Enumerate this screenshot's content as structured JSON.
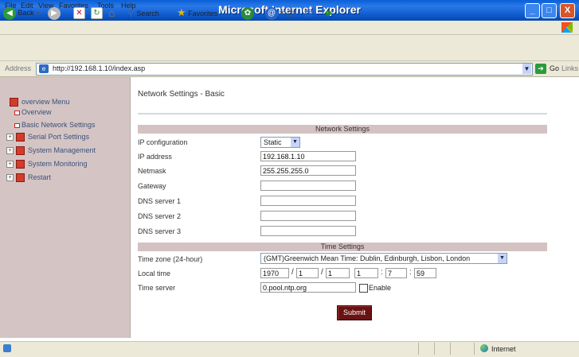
{
  "window": {
    "title": "Microsoft Internet Explorer",
    "min_glyph": "_",
    "max_glyph": "□",
    "close_glyph": "X"
  },
  "menubar": [
    "File",
    "Edit",
    "View",
    "Favorites",
    "Tools",
    "Help"
  ],
  "toolbar": {
    "back": "Back",
    "search": "Search",
    "favorites": "Favorites"
  },
  "address": {
    "label": "Address",
    "url": "http://192.168.1.10/index.asp",
    "go": "Go",
    "links": "Links"
  },
  "nav": {
    "header": "overview Menu",
    "items": [
      {
        "label": "Overview"
      },
      {
        "label": "Basic Network Settings"
      }
    ],
    "sections": [
      {
        "label": "Serial Port Settings"
      },
      {
        "label": "System Management"
      },
      {
        "label": "System Monitoring"
      },
      {
        "label": "Restart"
      }
    ]
  },
  "page": {
    "title": "Network Settings - Basic"
  },
  "network": {
    "header": "Network Settings",
    "ip_config_label": "IP configuration",
    "ip_config_value": "Static",
    "ip_address_label": "IP address",
    "ip_address": "192.168.1.10",
    "netmask_label": "Netmask",
    "netmask": "255.255.255.0",
    "gateway_label": "Gateway",
    "gateway": "",
    "dns1_label": "DNS server 1",
    "dns1": "",
    "dns2_label": "DNS server 2",
    "dns2": "",
    "dns3_label": "DNS server 3",
    "dns3": ""
  },
  "time": {
    "header": "Time Settings",
    "zone_label": "Time zone (24-hour)",
    "zone_value": "(GMT)Greenwich Mean Time: Dublin, Edinburgh, Lisbon, London",
    "local_label": "Local time",
    "year": "1970",
    "month": "1",
    "day": "1",
    "hour": "1",
    "minute": "7",
    "second": "59",
    "date_sep": "/",
    "time_sep": ":",
    "server_label": "Time server",
    "server": "0.pool.ntp.org",
    "enable_label": "Enable"
  },
  "submit": "Submit",
  "status": {
    "zone": "Internet"
  }
}
